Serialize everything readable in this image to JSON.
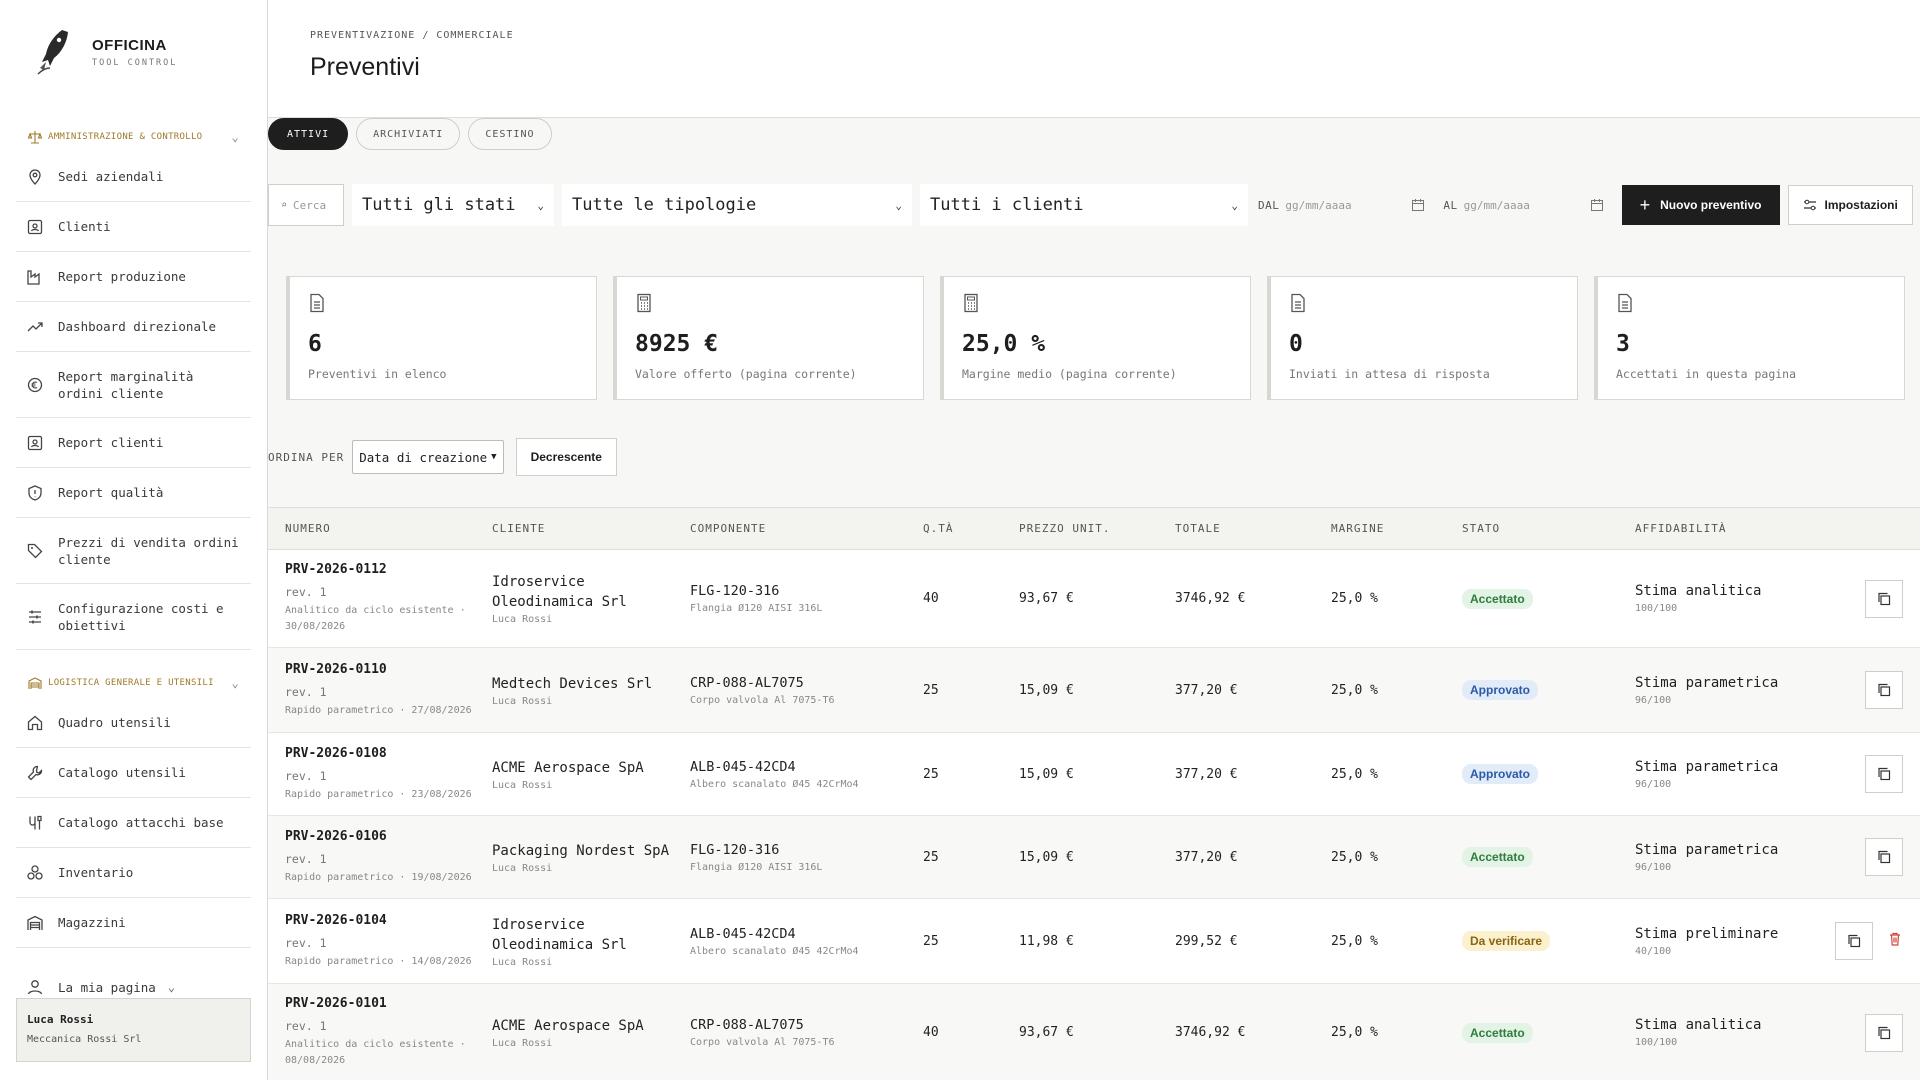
{
  "brand": {
    "name": "OFFICINA",
    "subtitle": "TOOL CONTROL"
  },
  "sidebar": {
    "sections": [
      {
        "title": "Amministrazione & Controllo",
        "items": [
          {
            "label": "Sedi aziendali",
            "icon": "location-pin-icon"
          },
          {
            "label": "Clienti",
            "icon": "contact-card-icon"
          },
          {
            "label": "Report produzione",
            "icon": "factory-icon"
          },
          {
            "label": "Dashboard direzionale",
            "icon": "trend-up-icon"
          },
          {
            "label": "Report marginalità ordini cliente",
            "icon": "euro-circle-icon"
          },
          {
            "label": "Report clienti",
            "icon": "contact-card-icon"
          },
          {
            "label": "Report qualità",
            "icon": "shield-alert-icon"
          },
          {
            "label": "Prezzi di vendita ordini cliente",
            "icon": "tag-icon"
          },
          {
            "label": "Configurazione costi e obiettivi",
            "icon": "sliders-icon"
          }
        ]
      },
      {
        "title": "Logistica generale e utensili",
        "items": [
          {
            "label": "Quadro utensili",
            "icon": "home-icon"
          },
          {
            "label": "Catalogo utensili",
            "icon": "wrench-icon"
          },
          {
            "label": "Catalogo attacchi base",
            "icon": "attachment-icon"
          },
          {
            "label": "Inventario",
            "icon": "boxes-icon"
          },
          {
            "label": "Magazzini",
            "icon": "warehouse-icon"
          }
        ]
      }
    ],
    "my_page": "La mia pagina",
    "user": {
      "name": "Luca Rossi",
      "company": "Meccanica Rossi Srl"
    }
  },
  "header": {
    "breadcrumb": "PREVENTIVAZIONE / COMMERCIALE",
    "title": "Preventivi"
  },
  "tabs": [
    {
      "label": "ATTIVI",
      "active": true
    },
    {
      "label": "ARCHIVIATI",
      "active": false
    },
    {
      "label": "CESTINO",
      "active": false
    }
  ],
  "filters": {
    "search_placeholder": "Cerca",
    "status": "Tutti gli stati",
    "type": "Tutte le tipologie",
    "client": "Tutti i clienti",
    "date_from_label": "DAL",
    "date_to_label": "AL",
    "date_placeholder": "gg/mm/aaaa",
    "new_button": "Nuovo preventivo",
    "settings_button": "Impostazioni"
  },
  "stats": [
    {
      "value": "6",
      "label": "Preventivi in elenco",
      "icon": "document-icon"
    },
    {
      "value": "8925 €",
      "label": "Valore offerto (pagina corrente)",
      "icon": "calculator-icon"
    },
    {
      "value": "25,0 %",
      "label": "Margine medio (pagina corrente)",
      "icon": "calculator-icon"
    },
    {
      "value": "0",
      "label": "Inviati in attesa di risposta",
      "icon": "document-icon"
    },
    {
      "value": "3",
      "label": "Accettati in questa pagina",
      "icon": "document-icon"
    }
  ],
  "sort": {
    "label": "ORDINA PER",
    "field": "Data di creazione",
    "direction": "Decrescente"
  },
  "table": {
    "columns": [
      "NUMERO",
      "CLIENTE",
      "COMPONENTE",
      "Q.TÀ",
      "PREZZO UNIT.",
      "TOTALE",
      "MARGINE",
      "STATO",
      "AFFIDABILITÀ"
    ],
    "rows": [
      {
        "number": "PRV-2026-0112",
        "rev": "rev. 1",
        "meta": "Analitico da ciclo esistente · 30/08/2026",
        "client": "Idroservice Oleodinamica Srl",
        "user": "Luca Rossi",
        "comp_code": "FLG-120-316",
        "comp_desc": "Flangia Ø120 AISI 316L",
        "qty": "40",
        "price": "93,67 €",
        "total": "3746,92 €",
        "margin": "25,0 %",
        "status": "Accettato",
        "aff": "Stima analitica",
        "score": "100/100"
      },
      {
        "number": "PRV-2026-0110",
        "rev": "rev. 1",
        "meta": "Rapido parametrico · 27/08/2026",
        "client": "Medtech Devices Srl",
        "user": "Luca Rossi",
        "comp_code": "CRP-088-AL7075",
        "comp_desc": "Corpo valvola Al 7075-T6",
        "qty": "25",
        "price": "15,09 €",
        "total": "377,20 €",
        "margin": "25,0 %",
        "status": "Approvato",
        "aff": "Stima parametrica",
        "score": "96/100"
      },
      {
        "number": "PRV-2026-0108",
        "rev": "rev. 1",
        "meta": "Rapido parametrico · 23/08/2026",
        "client": "ACME Aerospace SpA",
        "user": "Luca Rossi",
        "comp_code": "ALB-045-42CD4",
        "comp_desc": "Albero scanalato Ø45 42CrMo4",
        "qty": "25",
        "price": "15,09 €",
        "total": "377,20 €",
        "margin": "25,0 %",
        "status": "Approvato",
        "aff": "Stima parametrica",
        "score": "96/100"
      },
      {
        "number": "PRV-2026-0106",
        "rev": "rev. 1",
        "meta": "Rapido parametrico · 19/08/2026",
        "client": "Packaging Nordest SpA",
        "user": "Luca Rossi",
        "comp_code": "FLG-120-316",
        "comp_desc": "Flangia Ø120 AISI 316L",
        "qty": "25",
        "price": "15,09 €",
        "total": "377,20 €",
        "margin": "25,0 %",
        "status": "Accettato",
        "aff": "Stima parametrica",
        "score": "96/100"
      },
      {
        "number": "PRV-2026-0104",
        "rev": "rev. 1",
        "meta": "Rapido parametrico · 14/08/2026",
        "client": "Idroservice Oleodinamica Srl",
        "user": "Luca Rossi",
        "comp_code": "ALB-045-42CD4",
        "comp_desc": "Albero scanalato Ø45 42CrMo4",
        "qty": "25",
        "price": "11,98 €",
        "total": "299,52 €",
        "margin": "25,0 %",
        "status": "Da verificare",
        "aff": "Stima preliminare",
        "score": "40/100"
      },
      {
        "number": "PRV-2026-0101",
        "rev": "rev. 1",
        "meta": "Analitico da ciclo esistente · 08/08/2026",
        "client": "ACME Aerospace SpA",
        "user": "Luca Rossi",
        "comp_code": "CRP-088-AL7075",
        "comp_desc": "Corpo valvola Al 7075-T6",
        "qty": "40",
        "price": "93,67 €",
        "total": "3746,92 €",
        "margin": "25,0 %",
        "status": "Accettato",
        "aff": "Stima analitica",
        "score": "100/100"
      }
    ]
  },
  "colors": {
    "accent_dark": "#1e1e1e",
    "section_gold": "#a07a2a",
    "status_accepted_bg": "#e3f3e6",
    "status_accepted_fg": "#2e7d3d",
    "status_approved_bg": "#e2ebf8",
    "status_approved_fg": "#2b5aa6",
    "status_verify_bg": "#fbf1cf",
    "status_verify_fg": "#8a6410",
    "trash_red": "#d0453a"
  }
}
